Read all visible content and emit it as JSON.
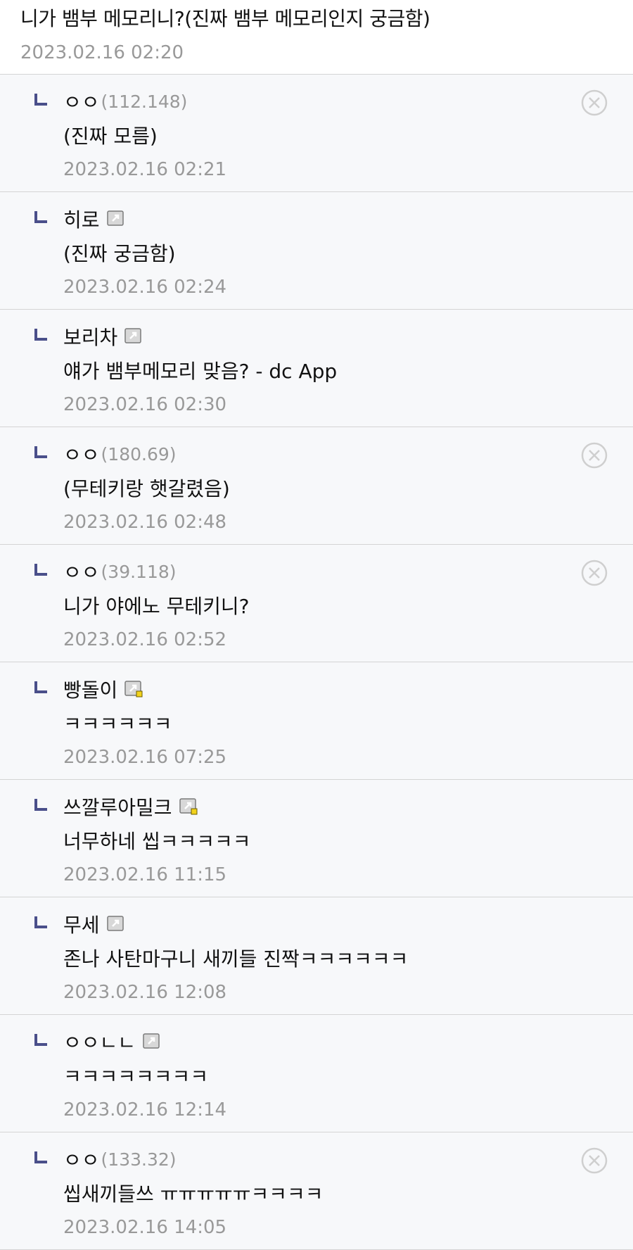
{
  "post": {
    "title": "니가 뱀부 메모리니?(진짜 뱀부 메모리인지 궁금함)",
    "date": "2023.02.16 02:20"
  },
  "colors": {
    "reply_mark": "#4a4f8a",
    "delete_icon": "#cfcfcf",
    "muted_text": "#999999"
  },
  "icons": {
    "reply": "reply-arrow-icon",
    "member": "gallery-member-icon",
    "delete": "delete-circle-icon"
  },
  "comments": [
    {
      "name": "ㅇㅇ",
      "ip": "(112.148)",
      "badge": "none",
      "deletable": true,
      "text": "(진짜 모름)",
      "date": "2023.02.16 02:21"
    },
    {
      "name": "히로",
      "ip": "",
      "badge": "member",
      "deletable": false,
      "text": "(진짜 궁금함)",
      "date": "2023.02.16 02:24"
    },
    {
      "name": "보리차",
      "ip": "",
      "badge": "member",
      "deletable": false,
      "text": "얘가 뱀부메모리 맞음? - dc App",
      "date": "2023.02.16 02:30"
    },
    {
      "name": "ㅇㅇ",
      "ip": "(180.69)",
      "badge": "none",
      "deletable": true,
      "text": "(무테키랑 햇갈렸음)",
      "date": "2023.02.16 02:48"
    },
    {
      "name": "ㅇㅇ",
      "ip": "(39.118)",
      "badge": "none",
      "deletable": true,
      "text": "니가 야에노 무테키니?",
      "date": "2023.02.16 02:52"
    },
    {
      "name": "빵돌이",
      "ip": "",
      "badge": "member-new",
      "deletable": false,
      "text": "ㅋㅋㅋㅋㅋㅋ",
      "date": "2023.02.16 07:25"
    },
    {
      "name": "쓰깔루아밀크",
      "ip": "",
      "badge": "member-new",
      "deletable": false,
      "text": "너무하네 씹ㅋㅋㅋㅋㅋ",
      "date": "2023.02.16 11:15"
    },
    {
      "name": "무세",
      "ip": "",
      "badge": "member",
      "deletable": false,
      "text": "존나 사탄마구니 새끼들 진짝ㅋㅋㅋㅋㅋㅋ",
      "date": "2023.02.16 12:08"
    },
    {
      "name": "ㅇㅇㄴㄴ",
      "ip": "",
      "badge": "member",
      "deletable": false,
      "text": "ㅋㅋㅋㅋㅋㅋㅋㅋ",
      "date": "2023.02.16 12:14"
    },
    {
      "name": "ㅇㅇ",
      "ip": "(133.32)",
      "badge": "none",
      "deletable": true,
      "text": "씹새끼들쓰 ㅠㅠㅠㅠㅠㅋㅋㅋㅋ",
      "date": "2023.02.16 14:05"
    }
  ]
}
